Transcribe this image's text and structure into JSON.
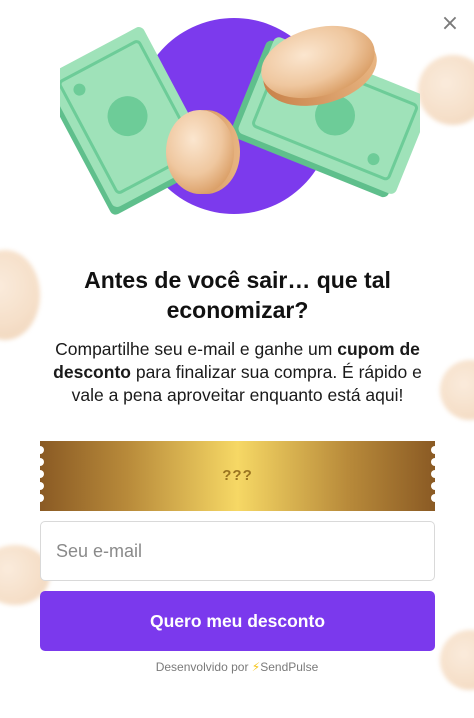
{
  "popup": {
    "close_label": "×",
    "title": "Antes de você sair… que tal economizar?",
    "description": {
      "part1": "Compartilhe seu e-mail e ganhe um ",
      "bold": "cupom de desconto",
      "part2": " para finalizar sua compra. É rápido e vale a pena aproveitar enquanto está aqui!"
    },
    "coupon": {
      "code_placeholder": "???"
    },
    "email_field": {
      "placeholder": "Seu e-mail",
      "value": ""
    },
    "submit_label": "Quero meu desconto",
    "powered_by": {
      "prefix": "Desenvolvido por",
      "brand": "SendPulse"
    }
  },
  "icons": [
    "close-icon",
    "money-bill-icon",
    "coin-icon",
    "lightning-bolt-icon"
  ],
  "colors": {
    "accent": "#7b39ed",
    "hero_circle": "#7c3aed",
    "bill_green": "#8fdcad",
    "coin": "#efc79f",
    "ticket_gold": "#e3c063"
  }
}
